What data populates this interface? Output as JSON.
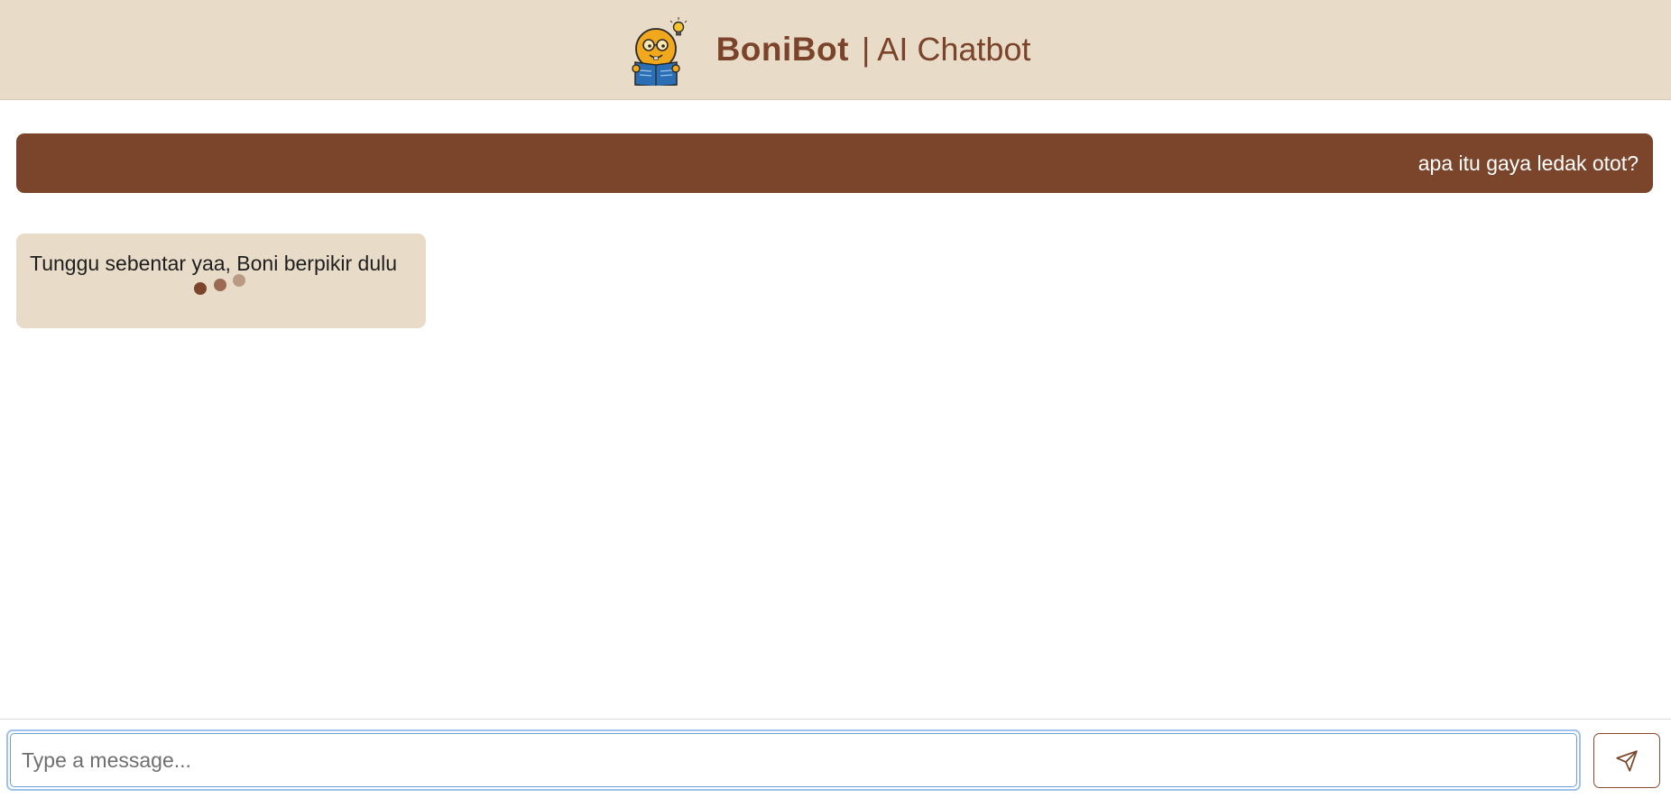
{
  "header": {
    "app_name": "BoniBot",
    "subtitle": "| AI Chatbot",
    "logo_icon": "reading-mascot-with-lightbulb-icon"
  },
  "colors": {
    "header_bg": "#e8dcc9",
    "brand_brown": "#7b452b",
    "bot_bubble_bg": "#e8dcc9",
    "input_focus": "#9fc2ee"
  },
  "messages": [
    {
      "role": "user",
      "text": "apa itu gaya ledak otot?"
    },
    {
      "role": "bot",
      "text": "Tunggu sebentar yaa, Boni berpikir dulu",
      "typing_indicator": true
    }
  ],
  "composer": {
    "placeholder": "Type a message...",
    "value": "",
    "send_icon": "paper-plane-icon"
  }
}
